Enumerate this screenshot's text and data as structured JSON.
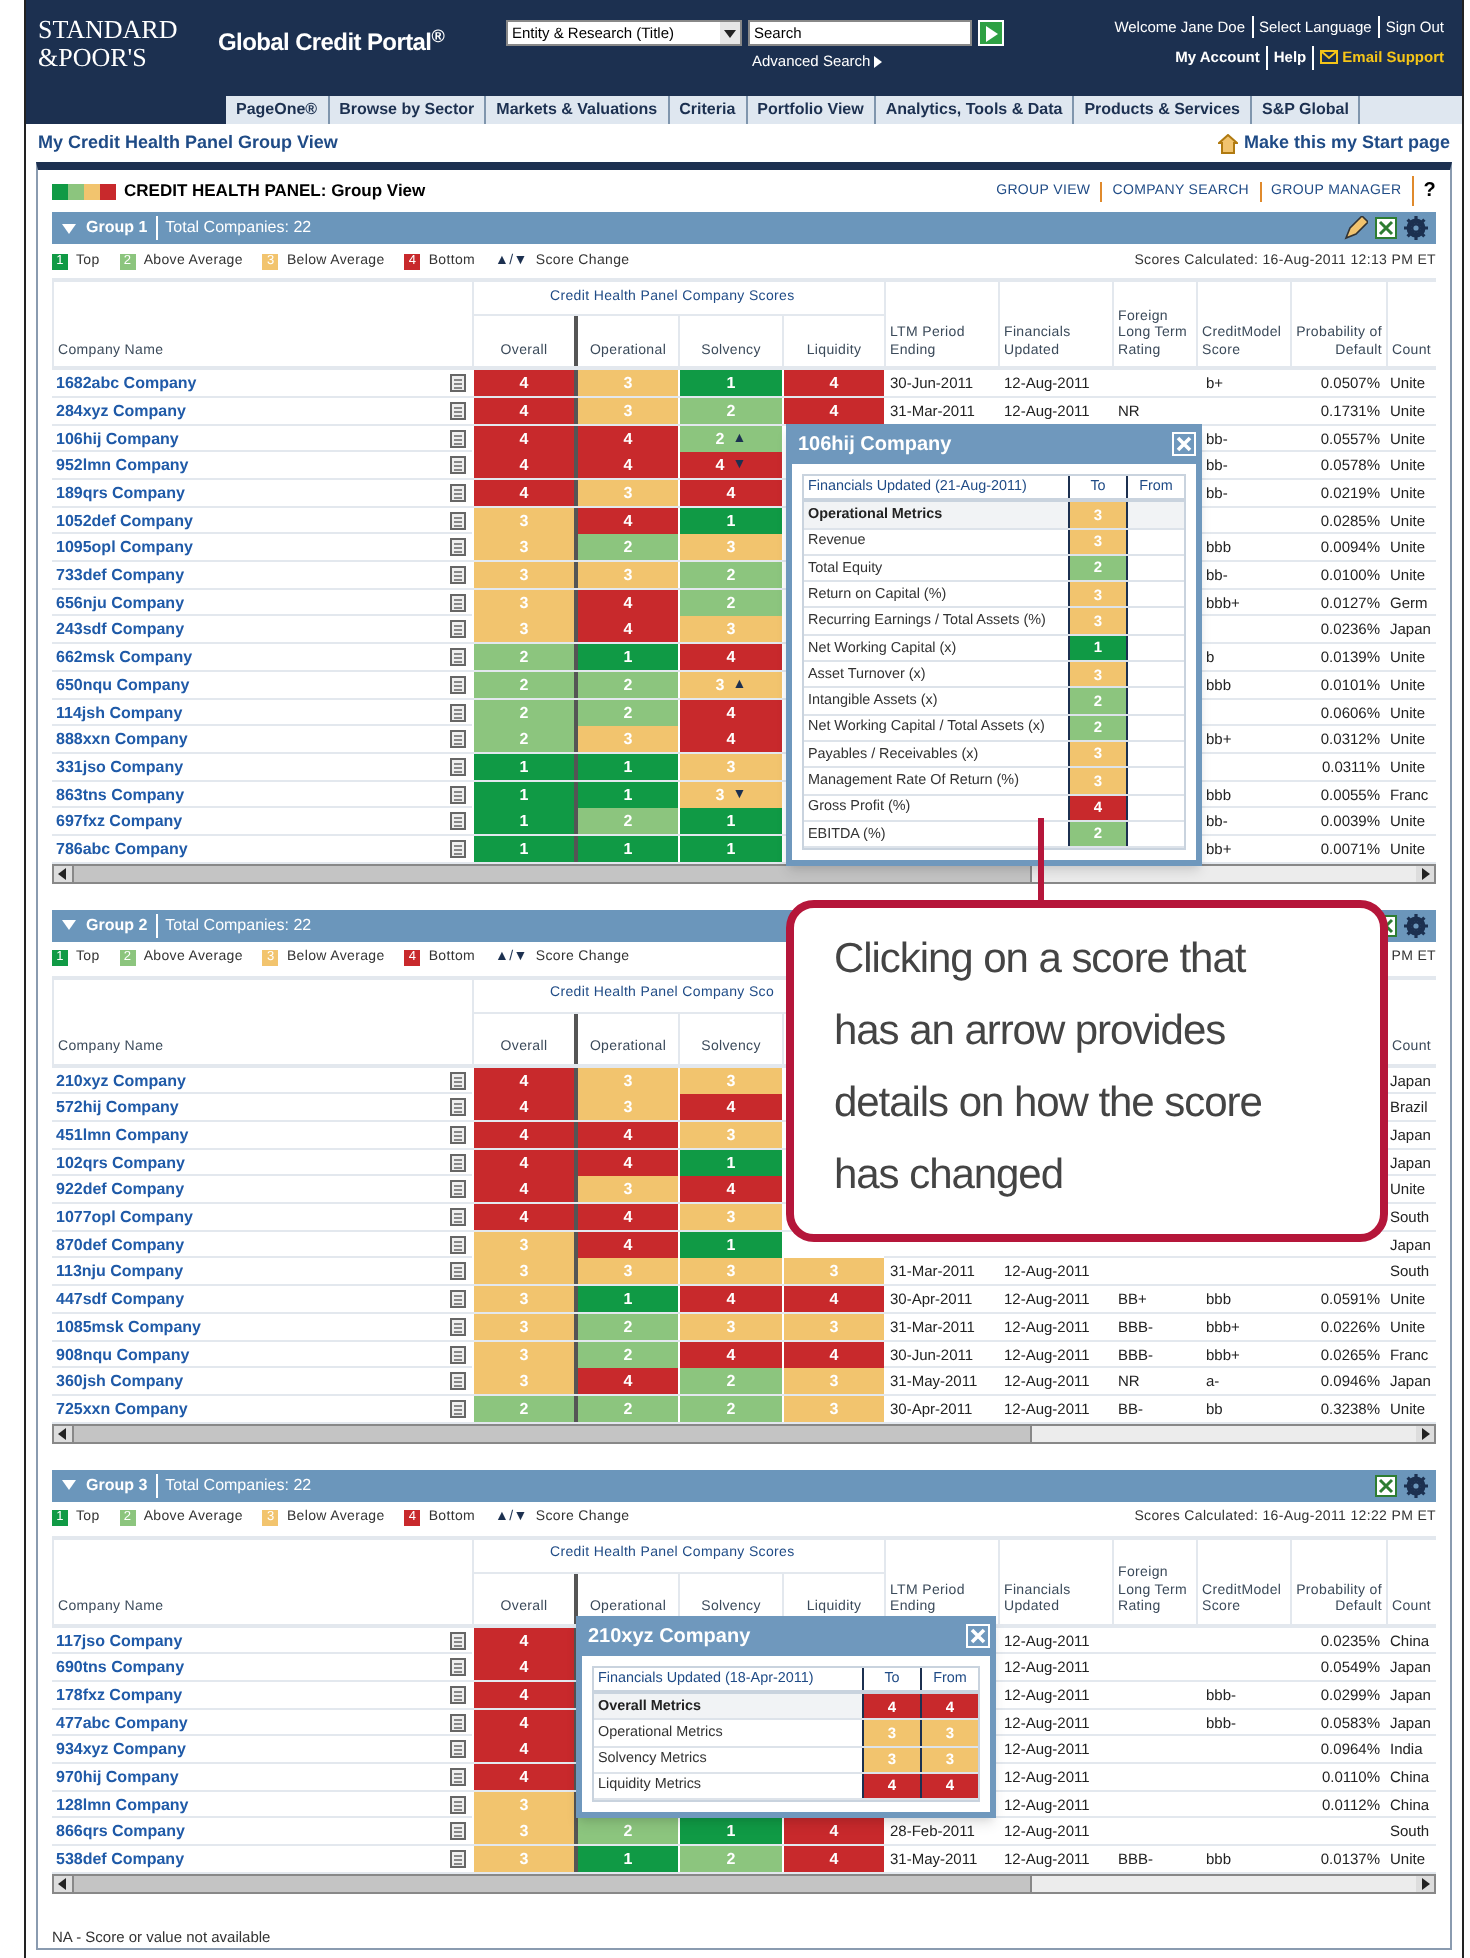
{
  "header": {
    "logo": [
      "STANDARD",
      "&POOR'S"
    ],
    "title": "Global Credit Portal$^{®}$",
    "search_scope": "Entity & Research (Title)",
    "search": {
      "placeholder": "Search"
    },
    "advanced_search": "Advanced Search",
    "user_links": [
      "Welcome Jane Doe",
      "Select Language",
      "Sign Out"
    ],
    "account_links": [
      "My Account",
      "Help",
      "Email Support"
    ]
  },
  "nav_tabs": [
    "PageOne®",
    "Browse by Sector",
    "Markets & Valuations",
    "Criteria",
    "Portfolio View",
    "Analytics, Tools & Data",
    "Products & Services",
    "S&P Global"
  ],
  "page_title": "My Credit Health Panel Group View",
  "start_page_link": "Make this my Start page",
  "panel": {
    "title": "CREDIT HEALTH PANEL: Group View",
    "links": [
      "GROUP VIEW",
      "COMPANY SEARCH",
      "GROUP MANAGER"
    ],
    "help": "?"
  },
  "groups": [
    {
      "name": "Group 1",
      "total": "Total Companies: 22",
      "legend": [
        {
          "color": "#109a45",
          "mark": "1",
          "label": "Top"
        },
        {
          "color": "#8cc57e",
          "mark": "2",
          "label": "Above Average"
        },
        {
          "color": "#f2c46e",
          "mark": "3",
          "label": "Below Average"
        },
        {
          "color": "#c8292c",
          "mark": "4",
          "label": "Bottom"
        }
      ],
      "change_symbols": "▲/▼",
      "change_label": "Score Change",
      "scores_calculated": "Scores Calculated: 16-Aug-2011 12:13 PM ET",
      "scores_header": "Credit Health Panel Company Scores",
      "columns": {
        "company_name": "Company Name",
        "overall": "Overall",
        "operational": "Operational",
        "solvency": "Solvency",
        "liquidity": "Liquidity",
        "ltm_period_ending": "LTM Period Ending",
        "financials_updated": "Financials Updated",
        "foreign_long_term_rating": "Foreign Long Term Rating",
        "creditmodel_score": "CreditModel Score",
        "probability_of_default": "Probability of Default",
        "column_11": "Count"
      },
      "rows": [
        {
          "company_name": "1682abc Company",
          "overall": {
            "color": "#c8292c",
            "score": "4"
          },
          "operational": {
            "color": "#f2c46e",
            "score": "3"
          },
          "solvency": {
            "color": "#109a45",
            "score": "1"
          },
          "liquidity": {
            "color": "#c8292c",
            "score": "4"
          },
          "ltm_period_ending": "30-Jun-2011",
          "financials_updated": "12-Aug-2011",
          "creditmodel_score": "b+",
          "probability_of_default": "0.0507%",
          "column_11": "Unite"
        },
        {
          "company_name": "284xyz Company",
          "overall": {
            "color": "#c8292c",
            "score": "4"
          },
          "operational": {
            "color": "#f2c46e",
            "score": "3"
          },
          "solvency": {
            "color": "#8cc57e",
            "score": "2"
          },
          "liquidity": {
            "color": "#c8292c",
            "score": "4"
          },
          "ltm_period_ending": "31-Mar-2011",
          "financials_updated": "12-Aug-2011",
          "foreign_long_term_rating": "NR",
          "probability_of_default": "0.1731%",
          "column_11": "Unite"
        },
        {
          "company_name": "106hij Company",
          "overall": {
            "color": "#c8292c",
            "score": "4"
          },
          "operational": {
            "color": "#c8292c",
            "score": "4"
          },
          "solvency": {
            "color": "#8cc57e",
            "score": "2",
            "arrow": "▲"
          },
          "creditmodel_score": "bb-",
          "probability_of_default": "0.0557%",
          "column_11": "Unite"
        },
        {
          "company_name": "952lmn Company",
          "overall": {
            "color": "#c8292c",
            "score": "4"
          },
          "operational": {
            "color": "#c8292c",
            "score": "4"
          },
          "solvency": {
            "color": "#c8292c",
            "score": "4",
            "arrow": "▼"
          },
          "creditmodel_score": "bb-",
          "probability_of_default": "0.0578%",
          "column_11": "Unite"
        },
        {
          "company_name": "189qrs Company",
          "overall": {
            "color": "#c8292c",
            "score": "4"
          },
          "operational": {
            "color": "#f2c46e",
            "score": "3"
          },
          "solvency": {
            "color": "#c8292c",
            "score": "4"
          },
          "creditmodel_score": "bb-",
          "probability_of_default": "0.0219%",
          "column_11": "Unite"
        },
        {
          "company_name": "1052def Company",
          "overall": {
            "color": "#f2c46e",
            "score": "3"
          },
          "operational": {
            "color": "#c8292c",
            "score": "4"
          },
          "solvency": {
            "color": "#109a45",
            "score": "1"
          },
          "probability_of_default": "0.0285%",
          "column_11": "Unite"
        },
        {
          "company_name": "1095opl Company",
          "overall": {
            "color": "#f2c46e",
            "score": "3"
          },
          "operational": {
            "color": "#8cc57e",
            "score": "2"
          },
          "solvency": {
            "color": "#f2c46e",
            "score": "3"
          },
          "creditmodel_score": "bbb",
          "probability_of_default": "0.0094%",
          "column_11": "Unite"
        },
        {
          "company_name": "733def Company",
          "overall": {
            "color": "#f2c46e",
            "score": "3"
          },
          "operational": {
            "color": "#f2c46e",
            "score": "3"
          },
          "solvency": {
            "color": "#8cc57e",
            "score": "2"
          },
          "creditmodel_score": "bb-",
          "probability_of_default": "0.0100%",
          "column_11": "Unite"
        },
        {
          "company_name": "656nju Company",
          "overall": {
            "color": "#f2c46e",
            "score": "3"
          },
          "operational": {
            "color": "#c8292c",
            "score": "4"
          },
          "solvency": {
            "color": "#8cc57e",
            "score": "2"
          },
          "creditmodel_score": "bbb+",
          "probability_of_default": "0.0127%",
          "column_11": "Germ"
        },
        {
          "company_name": "243sdf Company",
          "overall": {
            "color": "#f2c46e",
            "score": "3"
          },
          "operational": {
            "color": "#c8292c",
            "score": "4"
          },
          "solvency": {
            "color": "#f2c46e",
            "score": "3"
          },
          "probability_of_default": "0.0236%",
          "column_11": "Japan"
        },
        {
          "company_name": "662msk Company",
          "overall": {
            "color": "#8cc57e",
            "score": "2"
          },
          "operational": {
            "color": "#109a45",
            "score": "1"
          },
          "solvency": {
            "color": "#c8292c",
            "score": "4"
          },
          "creditmodel_score": "b",
          "probability_of_default": "0.0139%",
          "column_11": "Unite"
        },
        {
          "company_name": "650nqu Company",
          "overall": {
            "color": "#8cc57e",
            "score": "2"
          },
          "operational": {
            "color": "#8cc57e",
            "score": "2"
          },
          "solvency": {
            "color": "#f2c46e",
            "score": "3",
            "arrow": "▲"
          },
          "creditmodel_score": "bbb",
          "probability_of_default": "0.0101%",
          "column_11": "Unite"
        },
        {
          "company_name": "114jsh Company",
          "overall": {
            "color": "#8cc57e",
            "score": "2"
          },
          "operational": {
            "color": "#8cc57e",
            "score": "2"
          },
          "solvency": {
            "color": "#c8292c",
            "score": "4"
          },
          "probability_of_default": "0.0606%",
          "column_11": "Unite"
        },
        {
          "company_name": "888xxn Company",
          "overall": {
            "color": "#8cc57e",
            "score": "2"
          },
          "operational": {
            "color": "#f2c46e",
            "score": "3"
          },
          "solvency": {
            "color": "#c8292c",
            "score": "4"
          },
          "creditmodel_score": "bb+",
          "probability_of_default": "0.0312%",
          "column_11": "Unite"
        },
        {
          "company_name": "331jso Company",
          "overall": {
            "color": "#109a45",
            "score": "1"
          },
          "operational": {
            "color": "#109a45",
            "score": "1"
          },
          "solvency": {
            "color": "#f2c46e",
            "score": "3"
          },
          "probability_of_default": "0.0311%",
          "column_11": "Unite"
        },
        {
          "company_name": "863tns Company",
          "overall": {
            "color": "#109a45",
            "score": "1"
          },
          "operational": {
            "color": "#109a45",
            "score": "1"
          },
          "solvency": {
            "color": "#f2c46e",
            "score": "3",
            "arrow": "▼"
          },
          "creditmodel_score": "bbb",
          "probability_of_default": "0.0055%",
          "column_11": "Franc"
        },
        {
          "company_name": "697fxz Company",
          "overall": {
            "color": "#109a45",
            "score": "1"
          },
          "operational": {
            "color": "#8cc57e",
            "score": "2"
          },
          "solvency": {
            "color": "#109a45",
            "score": "1"
          },
          "creditmodel_score": "bb-",
          "probability_of_default": "0.0039%",
          "column_11": "Unite"
        },
        {
          "company_name": "786abc Company",
          "overall": {
            "color": "#109a45",
            "score": "1"
          },
          "operational": {
            "color": "#109a45",
            "score": "1"
          },
          "solvency": {
            "color": "#109a45",
            "score": "1"
          },
          "creditmodel_score": "bb+",
          "probability_of_default": "0.0071%",
          "column_11": "Unite"
        }
      ]
    },
    {
      "name": "Group 2",
      "total": "Total Companies: 22",
      "legend": [
        {
          "color": "#109a45",
          "mark": "1",
          "label": "Top"
        },
        {
          "color": "#8cc57e",
          "mark": "2",
          "label": "Above Average"
        },
        {
          "color": "#f2c46e",
          "mark": "3",
          "label": "Below Average"
        },
        {
          "color": "#c8292c",
          "mark": "4",
          "label": "Bottom"
        }
      ],
      "change_symbols": "▲/▼",
      "change_label": "Score Change",
      "scores_calculated": "PM ET",
      "scores_header": "Credit Health Panel Company Sco",
      "columns": {
        "company_name": "Company Name",
        "overall": "Overall",
        "operational": "Operational",
        "solvency": "Solvency",
        "column_11": "Count"
      },
      "rows": [
        {
          "company_name": "210xyz Company",
          "overall": {
            "color": "#c8292c",
            "score": "4"
          },
          "operational": {
            "color": "#f2c46e",
            "score": "3"
          },
          "solvency": {
            "color": "#f2c46e",
            "score": "3"
          },
          "column_11": "Japan"
        },
        {
          "company_name": "572hij Company",
          "overall": {
            "color": "#c8292c",
            "score": "4"
          },
          "operational": {
            "color": "#f2c46e",
            "score": "3"
          },
          "solvency": {
            "color": "#c8292c",
            "score": "4"
          },
          "column_11": "Brazil"
        },
        {
          "company_name": "451lmn Company",
          "overall": {
            "color": "#c8292c",
            "score": "4"
          },
          "operational": {
            "color": "#c8292c",
            "score": "4"
          },
          "solvency": {
            "color": "#f2c46e",
            "score": "3"
          },
          "column_11": "Japan"
        },
        {
          "company_name": "102qrs Company",
          "overall": {
            "color": "#c8292c",
            "score": "4"
          },
          "operational": {
            "color": "#c8292c",
            "score": "4"
          },
          "solvency": {
            "color": "#109a45",
            "score": "1"
          },
          "column_11": "Japan"
        },
        {
          "company_name": "922def Company",
          "overall": {
            "color": "#c8292c",
            "score": "4"
          },
          "operational": {
            "color": "#f2c46e",
            "score": "3"
          },
          "solvency": {
            "color": "#c8292c",
            "score": "4"
          },
          "column_11": "Unite"
        },
        {
          "company_name": "1077opl Company",
          "overall": {
            "color": "#c8292c",
            "score": "4"
          },
          "operational": {
            "color": "#c8292c",
            "score": "4"
          },
          "solvency": {
            "color": "#f2c46e",
            "score": "3"
          },
          "column_11": "South"
        },
        {
          "company_name": "870def Company",
          "overall": {
            "color": "#f2c46e",
            "score": "3"
          },
          "operational": {
            "color": "#c8292c",
            "score": "4"
          },
          "solvency": {
            "color": "#109a45",
            "score": "1"
          },
          "column_11": "Japan"
        },
        {
          "company_name": "113nju Company",
          "overall": {
            "color": "#f2c46e",
            "score": "3"
          },
          "operational": {
            "color": "#f2c46e",
            "score": "3"
          },
          "solvency": {
            "color": "#f2c46e",
            "score": "3"
          },
          "liquidity": {
            "color": "#f2c46e",
            "score": "3"
          },
          "ltm_period_ending": "31-Mar-2011",
          "financials_updated": "12-Aug-2011",
          "column_11": "South"
        },
        {
          "company_name": "447sdf Company",
          "overall": {
            "color": "#f2c46e",
            "score": "3"
          },
          "operational": {
            "color": "#109a45",
            "score": "1"
          },
          "solvency": {
            "color": "#c8292c",
            "score": "4"
          },
          "liquidity": {
            "color": "#c8292c",
            "score": "4"
          },
          "ltm_period_ending": "30-Apr-2011",
          "financials_updated": "12-Aug-2011",
          "foreign_long_term_rating": "BB+",
          "creditmodel_score": "bbb",
          "probability_of_default": "0.0591%",
          "column_11": "Unite"
        },
        {
          "company_name": "1085msk Company",
          "overall": {
            "color": "#f2c46e",
            "score": "3"
          },
          "operational": {
            "color": "#8cc57e",
            "score": "2"
          },
          "solvency": {
            "color": "#f2c46e",
            "score": "3"
          },
          "liquidity": {
            "color": "#f2c46e",
            "score": "3"
          },
          "ltm_period_ending": "31-Mar-2011",
          "financials_updated": "12-Aug-2011",
          "foreign_long_term_rating": "BBB-",
          "creditmodel_score": "bbb+",
          "probability_of_default": "0.0226%",
          "column_11": "Unite"
        },
        {
          "company_name": "908nqu Company",
          "overall": {
            "color": "#f2c46e",
            "score": "3"
          },
          "operational": {
            "color": "#8cc57e",
            "score": "2"
          },
          "solvency": {
            "color": "#c8292c",
            "score": "4"
          },
          "liquidity": {
            "color": "#c8292c",
            "score": "4"
          },
          "ltm_period_ending": "30-Jun-2011",
          "financials_updated": "12-Aug-2011",
          "foreign_long_term_rating": "BBB-",
          "creditmodel_score": "bbb+",
          "probability_of_default": "0.0265%",
          "column_11": "Franc"
        },
        {
          "company_name": "360jsh Company",
          "overall": {
            "color": "#f2c46e",
            "score": "3"
          },
          "operational": {
            "color": "#c8292c",
            "score": "4"
          },
          "solvency": {
            "color": "#8cc57e",
            "score": "2"
          },
          "liquidity": {
            "color": "#f2c46e",
            "score": "3"
          },
          "ltm_period_ending": "31-May-2011",
          "financials_updated": "12-Aug-2011",
          "foreign_long_term_rating": "NR",
          "creditmodel_score": "a-",
          "probability_of_default": "0.0946%",
          "column_11": "Japan"
        },
        {
          "company_name": "725xxn Company",
          "overall": {
            "color": "#8cc57e",
            "score": "2"
          },
          "operational": {
            "color": "#8cc57e",
            "score": "2"
          },
          "solvency": {
            "color": "#8cc57e",
            "score": "2"
          },
          "liquidity": {
            "color": "#f2c46e",
            "score": "3"
          },
          "ltm_period_ending": "30-Apr-2011",
          "financials_updated": "12-Aug-2011",
          "foreign_long_term_rating": "BB-",
          "creditmodel_score": "bb",
          "probability_of_default": "0.3238%",
          "column_11": "Unite"
        }
      ]
    },
    {
      "name": "Group 3",
      "total": "Total Companies: 22",
      "legend": [
        {
          "color": "#109a45",
          "mark": "1",
          "label": "Top"
        },
        {
          "color": "#8cc57e",
          "mark": "2",
          "label": "Above Average"
        },
        {
          "color": "#f2c46e",
          "mark": "3",
          "label": "Below Average"
        },
        {
          "color": "#c8292c",
          "mark": "4",
          "label": "Bottom"
        }
      ],
      "change_symbols": "▲/▼",
      "change_label": "Score Change",
      "scores_calculated": "Scores Calculated: 16-Aug-2011 12:22 PM ET",
      "scores_header": "Credit Health Panel Company Scores",
      "columns": {
        "company_name": "Company Name",
        "overall": "Overall",
        "operational": "Operational",
        "solvency": "Solvency",
        "liquidity": "Liquidity",
        "ltm_period_ending": "LTM Period Ending",
        "financials_updated": "Financials Updated",
        "foreign_long_term_rating": "Foreign Long Term Rating",
        "creditmodel_score": "CreditModel Score",
        "probability_of_default": "Probability of Default",
        "column_11": "Count"
      },
      "rows": [
        {
          "company_name": "117jso Company",
          "overall": {
            "color": "#c8292c",
            "score": "4"
          },
          "financials_updated": "12-Aug-2011",
          "probability_of_default": "0.0235%",
          "column_11": "China"
        },
        {
          "company_name": "690tns Company",
          "overall": {
            "color": "#c8292c",
            "score": "4"
          },
          "financials_updated": "12-Aug-2011",
          "probability_of_default": "0.0549%",
          "column_11": "Japan"
        },
        {
          "company_name": "178fxz Company",
          "overall": {
            "color": "#c8292c",
            "score": "4"
          },
          "financials_updated": "12-Aug-2011",
          "creditmodel_score": "bbb-",
          "probability_of_default": "0.0299%",
          "column_11": "Japan"
        },
        {
          "company_name": "477abc Company",
          "overall": {
            "color": "#c8292c",
            "score": "4"
          },
          "financials_updated": "12-Aug-2011",
          "creditmodel_score": "bbb-",
          "probability_of_default": "0.0583%",
          "column_11": "Japan"
        },
        {
          "company_name": "934xyz Company",
          "overall": {
            "color": "#c8292c",
            "score": "4"
          },
          "financials_updated": "12-Aug-2011",
          "probability_of_default": "0.0964%",
          "column_11": "India"
        },
        {
          "company_name": "970hij Company",
          "overall": {
            "color": "#c8292c",
            "score": "4"
          },
          "financials_updated": "12-Aug-2011",
          "probability_of_default": "0.0110%",
          "column_11": "China"
        },
        {
          "company_name": "128lmn Company",
          "overall": {
            "color": "#f2c46e",
            "score": "3"
          },
          "financials_updated": "12-Aug-2011",
          "probability_of_default": "0.0112%",
          "column_11": "China"
        },
        {
          "company_name": "866qrs Company",
          "overall": {
            "color": "#f2c46e",
            "score": "3"
          },
          "operational": {
            "color": "#8cc57e",
            "score": "2"
          },
          "solvency": {
            "color": "#109a45",
            "score": "1"
          },
          "liquidity": {
            "color": "#c8292c",
            "score": "4"
          },
          "ltm_period_ending": "28-Feb-2011",
          "financials_updated": "12-Aug-2011",
          "column_11": "South"
        },
        {
          "company_name": "538def Company",
          "overall": {
            "color": "#f2c46e",
            "score": "3"
          },
          "operational": {
            "color": "#109a45",
            "score": "1"
          },
          "solvency": {
            "color": "#8cc57e",
            "score": "2"
          },
          "liquidity": {
            "color": "#c8292c",
            "score": "4"
          },
          "ltm_period_ending": "31-May-2011",
          "financials_updated": "12-Aug-2011",
          "foreign_long_term_rating": "BBB-",
          "creditmodel_score": "bbb",
          "probability_of_default": "0.0137%",
          "column_11": "Unite"
        }
      ]
    }
  ],
  "popups": [
    {
      "title": "106hij Company",
      "subtitle": "Financials Updated (21-Aug-2011)",
      "columns": [
        "To",
        "From"
      ],
      "rows": [
        {
          "kind": "section",
          "label": "Operational Metrics",
          "to": {
            "color": "#f2c46e",
            "score": "3"
          }
        },
        {
          "kind": "metric",
          "label": "Revenue",
          "to": {
            "color": "#f2c46e",
            "score": "3"
          }
        },
        {
          "kind": "metric",
          "label": "Total Equity",
          "to": {
            "color": "#8cc57e",
            "score": "2"
          }
        },
        {
          "kind": "metric",
          "label": "Return on Capital (%)",
          "to": {
            "color": "#f2c46e",
            "score": "3"
          }
        },
        {
          "kind": "metric",
          "label": "Recurring Earnings / Total Assets (%)",
          "to": {
            "color": "#f2c46e",
            "score": "3"
          }
        },
        {
          "kind": "metric",
          "label": "Net Working Capital (x)",
          "to": {
            "color": "#109a45",
            "score": "1"
          }
        },
        {
          "kind": "metric",
          "label": "Asset Turnover (x)",
          "to": {
            "color": "#f2c46e",
            "score": "3"
          }
        },
        {
          "kind": "metric",
          "label": "Intangible Assets (x)",
          "to": {
            "color": "#8cc57e",
            "score": "2"
          }
        },
        {
          "kind": "metric",
          "label": "Net Working Capital / Total Assets (x)",
          "to": {
            "color": "#8cc57e",
            "score": "2"
          }
        },
        {
          "kind": "metric",
          "label": "Payables / Receivables (x)",
          "to": {
            "color": "#f2c46e",
            "score": "3"
          }
        },
        {
          "kind": "metric",
          "label": "Management Rate Of Return (%)",
          "to": {
            "color": "#f2c46e",
            "score": "3"
          }
        },
        {
          "kind": "metric",
          "label": "Gross Profit (%)",
          "to": {
            "color": "#c8292c",
            "score": "4"
          }
        },
        {
          "kind": "metric",
          "label": "EBITDA (%)",
          "to": {
            "color": "#8cc57e",
            "score": "2"
          }
        }
      ]
    },
    {
      "title": "210xyz Company",
      "subtitle": "Financials Updated (18-Apr-2011)",
      "columns": [
        "To",
        "From"
      ],
      "rows": [
        {
          "kind": "section",
          "label": "Overall Metrics",
          "to": {
            "color": "#c8292c",
            "score": "4"
          },
          "from": {
            "color": "#c8292c",
            "score": "4"
          }
        },
        {
          "kind": "metric",
          "label": "Operational Metrics",
          "to": {
            "color": "#f2c46e",
            "score": "3"
          },
          "from": {
            "color": "#f2c46e",
            "score": "3"
          }
        },
        {
          "kind": "metric",
          "label": "Solvency Metrics",
          "to": {
            "color": "#f2c46e",
            "score": "3"
          },
          "from": {
            "color": "#f2c46e",
            "score": "3"
          }
        },
        {
          "kind": "metric",
          "label": "Liquidity Metrics",
          "to": {
            "color": "#c8292c",
            "score": "4"
          },
          "from": {
            "color": "#c8292c",
            "score": "4"
          }
        }
      ]
    }
  ],
  "callout": {
    "text": "Clicking on a score that has an arrow provides details on how the score has changed"
  },
  "footnote": "NA - Score or value not available"
}
